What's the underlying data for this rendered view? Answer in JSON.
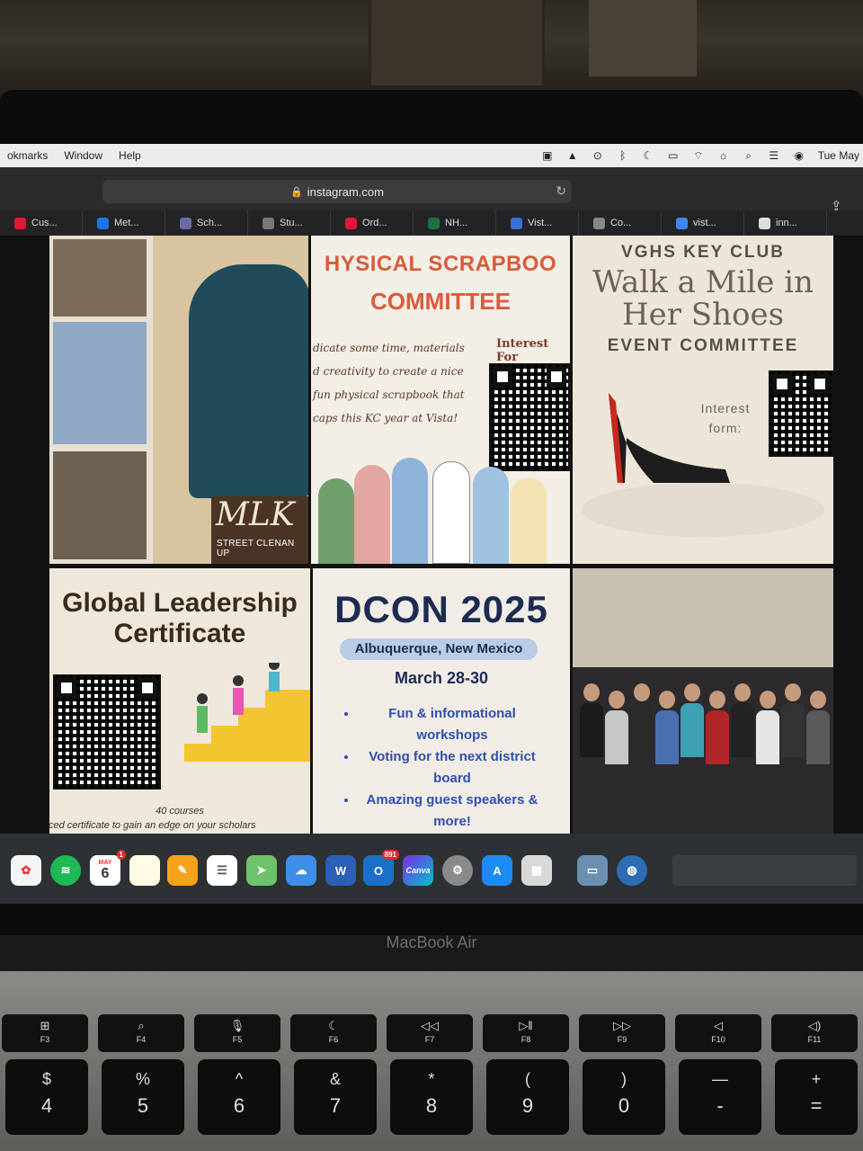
{
  "menubar": {
    "items": [
      "okmarks",
      "Window",
      "Help"
    ],
    "clock": "Tue May"
  },
  "browser": {
    "url": "instagram.com",
    "tabs": [
      {
        "label": "Cus...",
        "icon": "walgreens-icon",
        "color": "#e31837"
      },
      {
        "label": "Met...",
        "icon": "meta-icon",
        "color": "#1877f2"
      },
      {
        "label": "Sch...",
        "icon": "school-icon",
        "color": "#6a6aa8"
      },
      {
        "label": "Stu...",
        "icon": "s-icon",
        "color": "#777777"
      },
      {
        "label": "Ord...",
        "icon": "walgreens-icon",
        "color": "#e31837"
      },
      {
        "label": "NH...",
        "icon": "excel-icon",
        "color": "#1d7044"
      },
      {
        "label": "Vist...",
        "icon": "people-icon",
        "color": "#3b6fd8"
      },
      {
        "label": "Co...",
        "icon": "c-icon",
        "color": "#888888"
      },
      {
        "label": "vist...",
        "icon": "google-icon",
        "color": "#4285f4"
      },
      {
        "label": "inn...",
        "icon": "app-icon",
        "color": "#dddddd"
      }
    ]
  },
  "posts": {
    "mlk": {
      "title": "MLK",
      "subtitle": "STREET CLENAN UP"
    },
    "scrapbook": {
      "line1": "HYSICAL SCRAPBOO",
      "line2": "COMMITTEE",
      "body": "dicate some time, materials d creativity to create a nice fun physical scrapbook that caps this KC year at Vista!",
      "interest": "Interest For"
    },
    "keyclub": {
      "club": "VGHS KEY CLUB",
      "title": "Walk a Mile in Her Shoes",
      "committee": "EVENT COMMITTEE",
      "interest": "Interest form:"
    },
    "leadership": {
      "title": "Global Leadership Certificate",
      "courses": "40 courses",
      "tagline": "f-paced certificate to gain an edge on your scholars"
    },
    "dcon": {
      "title": "DCON 2025",
      "location": "Albuquerque, New Mexico",
      "dates": "March 28-30",
      "bullets": [
        "Fun & informational workshops",
        "Voting for the next district board",
        "Amazing guest speakers & more!"
      ]
    }
  },
  "dock": {
    "calendar_month": "MAY",
    "calendar_day": "6",
    "calendar_badge": "1",
    "outlook_badge": "891",
    "canva_label": "Canva",
    "word_label": "W"
  },
  "laptop": {
    "brand": "MacBook Air",
    "fkeys": [
      {
        "sym": "⊞",
        "label": "F3"
      },
      {
        "sym": "⌕",
        "label": "F4"
      },
      {
        "sym": "🎙",
        "label": "F5"
      },
      {
        "sym": "☾",
        "label": "F6"
      },
      {
        "sym": "◁◁",
        "label": "F7"
      },
      {
        "sym": "▷‖",
        "label": "F8"
      },
      {
        "sym": "▷▷",
        "label": "F9"
      },
      {
        "sym": "◁",
        "label": "F10"
      },
      {
        "sym": "◁)",
        "label": "F11"
      }
    ],
    "numkeys": [
      {
        "top": "$",
        "bottom": "4"
      },
      {
        "top": "%",
        "bottom": "5"
      },
      {
        "top": "^",
        "bottom": "6"
      },
      {
        "top": "&",
        "bottom": "7"
      },
      {
        "top": "*",
        "bottom": "8"
      },
      {
        "top": "(",
        "bottom": "9"
      },
      {
        "top": ")",
        "bottom": "0"
      },
      {
        "top": "—",
        "bottom": "-"
      },
      {
        "top": "+",
        "bottom": "="
      }
    ]
  }
}
